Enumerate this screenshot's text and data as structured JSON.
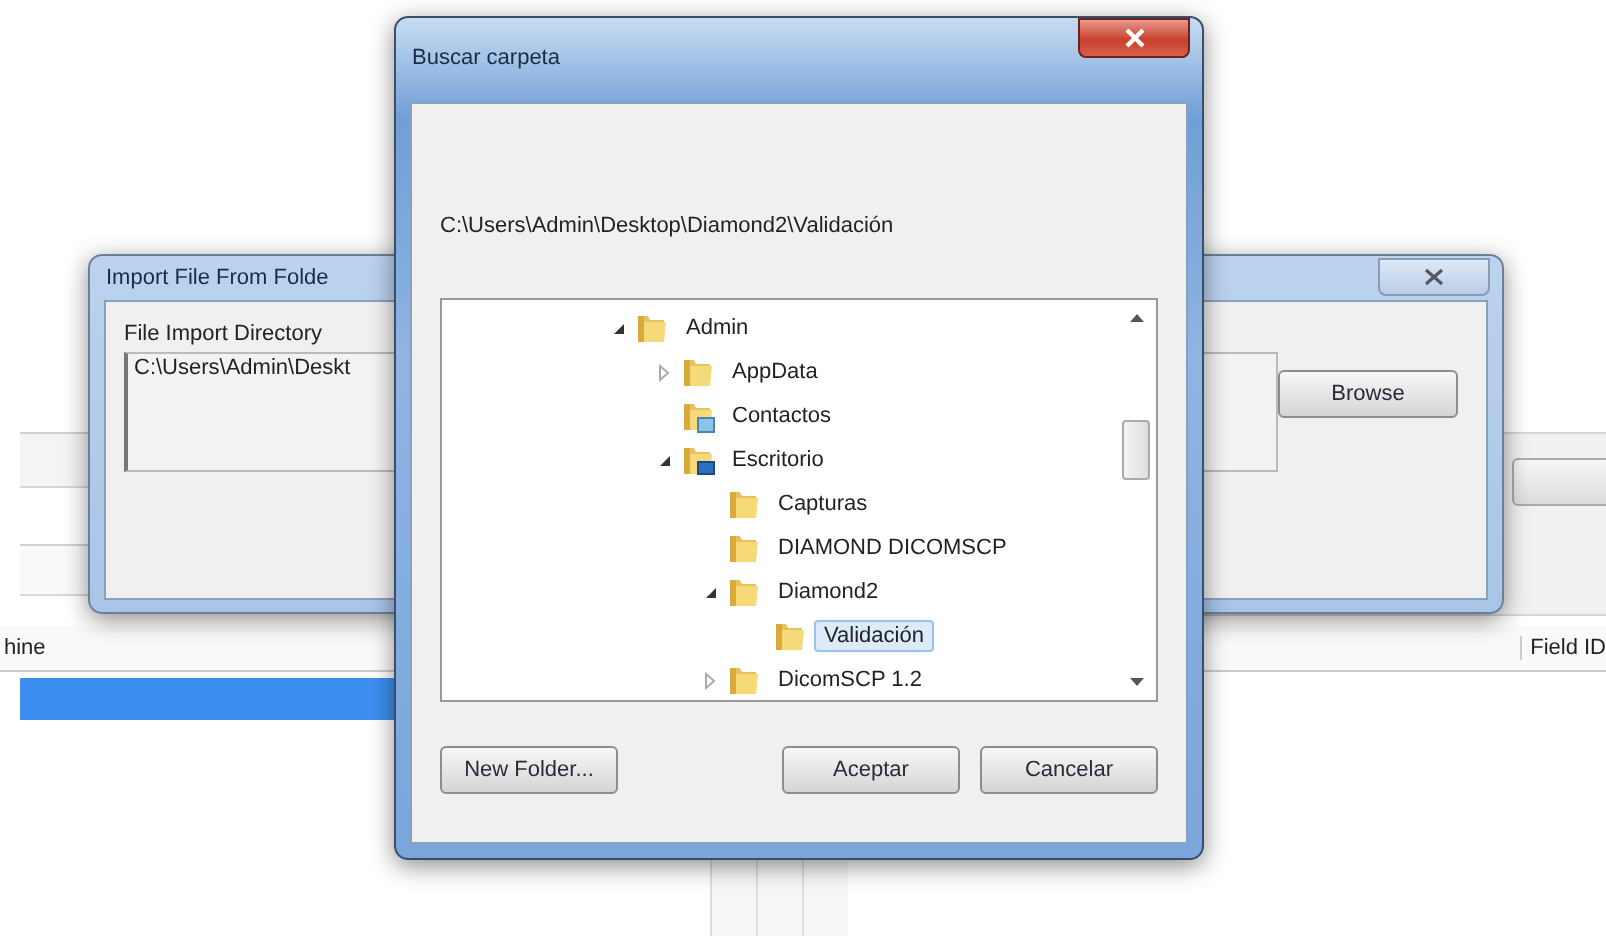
{
  "background_app": {
    "columns": [
      "hine",
      "Field ID"
    ],
    "rows": [
      {
        "selected": true
      }
    ]
  },
  "import_dialog": {
    "title": "Import File From Folde",
    "group_label": "File Import Directory",
    "directory_value": "C:\\Users\\Admin\\Deskt",
    "button": "Browse"
  },
  "folder_dialog": {
    "title": "Buscar carpeta",
    "path": "C:\\Users\\Admin\\Desktop\\Diamond2\\Validación",
    "tree": [
      {
        "label": "Admin",
        "kind": "folder",
        "expanded": true,
        "selected": false,
        "children": [
          {
            "label": "AppData",
            "kind": "folder",
            "expanded": false,
            "selected": false
          },
          {
            "label": "Contactos",
            "kind": "contacts",
            "selected": false
          },
          {
            "label": "Escritorio",
            "kind": "desktop",
            "expanded": true,
            "selected": false,
            "children": [
              {
                "label": "Capturas",
                "kind": "folder",
                "selected": false
              },
              {
                "label": "DIAMOND DICOMSCP",
                "kind": "folder",
                "selected": false
              },
              {
                "label": "Diamond2",
                "kind": "folder",
                "expanded": true,
                "selected": false,
                "children": [
                  {
                    "label": "Validación",
                    "kind": "folder",
                    "selected": true
                  }
                ]
              },
              {
                "label": "DicomSCP 1.2",
                "kind": "folder",
                "expanded": false,
                "selected": false
              }
            ]
          }
        ]
      }
    ],
    "buttons": [
      {
        "label": "New Folder..."
      },
      {
        "label": "Aceptar"
      },
      {
        "label": "Cancelar"
      }
    ]
  }
}
